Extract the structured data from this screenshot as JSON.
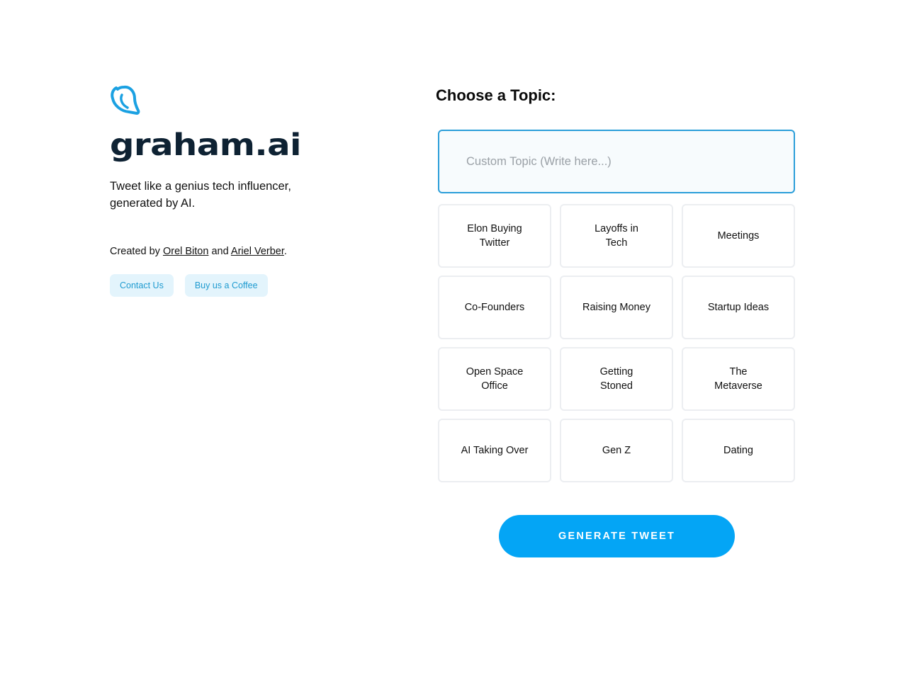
{
  "brand": {
    "logo_icon": "bird-icon",
    "name": "graham.ai",
    "accent_color": "#1ba1e2",
    "dark_color": "#0e2233"
  },
  "tagline": "Tweet like a genius tech influencer, generated by AI.",
  "credits": {
    "prefix": "Created by ",
    "author1": "Orel Biton",
    "middle": " and ",
    "author2": "Ariel Verber",
    "suffix": "."
  },
  "links": {
    "contact": "Contact Us",
    "coffee": "Buy us a Coffee"
  },
  "topic_section": {
    "heading": "Choose a Topic:",
    "custom_input": {
      "value": "",
      "placeholder": "Custom Topic (Write here...)"
    },
    "topics": [
      "Elon Buying Twitter",
      "Layoffs in Tech",
      "Meetings",
      "Co-Founders",
      "Raising Money",
      "Startup Ideas",
      "Open Space Office",
      "Getting Stoned",
      "The Metaverse",
      "AI Taking Over",
      "Gen Z",
      "Dating"
    ]
  },
  "generate_button": {
    "label": "GENERATE TWEET",
    "color": "#04a5f5"
  }
}
